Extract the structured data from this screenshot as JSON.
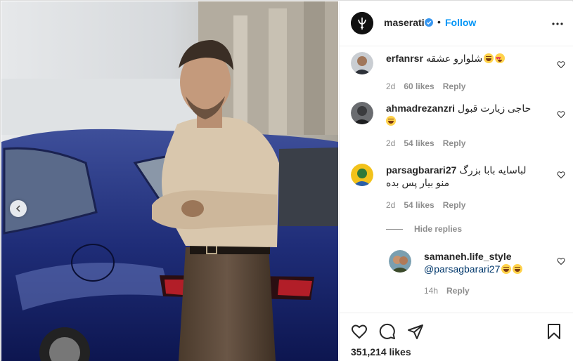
{
  "colors": {
    "accent": "#0095f6",
    "text": "#262626",
    "muted": "#8e8e8e",
    "mention": "#00376b"
  },
  "header": {
    "username": "maserati",
    "separator": "•",
    "follow_label": "Follow",
    "icons": [
      "verified-badge-icon",
      "more-options-icon"
    ]
  },
  "comments": [
    {
      "user": "erfanrsr",
      "text": "شلوارو عشقه",
      "emojis": [
        "laugh",
        "heart-eyes"
      ],
      "time": "2d",
      "likes": "60 likes",
      "reply": "Reply"
    },
    {
      "user": "ahmadrezanzri",
      "text": "حاجی زیارت قبول",
      "emojis": [
        "laugh"
      ],
      "time": "2d",
      "likes": "54 likes",
      "reply": "Reply"
    },
    {
      "user": "parsagbarari27",
      "text": "لباسایه بابا بزرگ",
      "text2": "منو بیار پس بده",
      "time": "2d",
      "likes": "54 likes",
      "reply": "Reply"
    }
  ],
  "hide_replies": "Hide replies",
  "reply": {
    "user": "samaneh.life_style",
    "mention": "@parsagbarari27",
    "emojis": [
      "laugh",
      "laugh"
    ],
    "time": "14h",
    "reply": "Reply"
  },
  "actions": {
    "icons": [
      "heart-icon",
      "comment-icon",
      "share-icon",
      "bookmark-icon"
    ],
    "likes": "351,214 likes"
  }
}
